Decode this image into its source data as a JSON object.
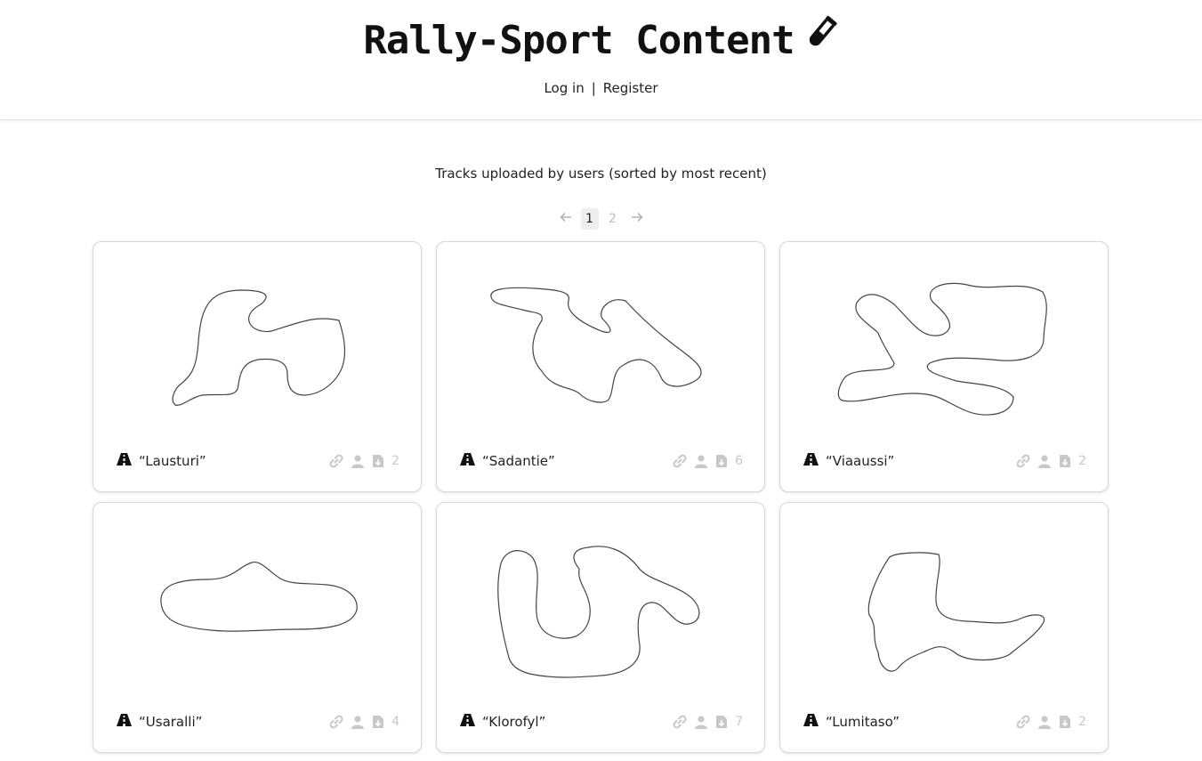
{
  "header": {
    "title": "Rally-Sport Content",
    "icon": "test-tube-icon",
    "login_label": "Log in",
    "separator": "|",
    "register_label": "Register"
  },
  "main": {
    "subtitle": "Tracks uploaded by users (sorted by most recent)",
    "pagination": {
      "prev_icon": "arrow-left-icon",
      "next_icon": "arrow-right-icon",
      "pages": [
        "1",
        "2"
      ],
      "current": "1"
    },
    "tracks": [
      {
        "name": "“Lausturi”",
        "downloads": "2"
      },
      {
        "name": "“Sadantie”",
        "downloads": "6"
      },
      {
        "name": "“Viaaussi”",
        "downloads": "2"
      },
      {
        "name": "“Usaralli”",
        "downloads": "4"
      },
      {
        "name": "“Klorofyl”",
        "downloads": "7"
      },
      {
        "name": "“Lumitaso”",
        "downloads": "2"
      }
    ]
  },
  "colors": {
    "border": "#d8d8d8",
    "muted_icon": "#c8c8c8",
    "text": "#222222",
    "page_active_bg": "#eeeeee"
  }
}
